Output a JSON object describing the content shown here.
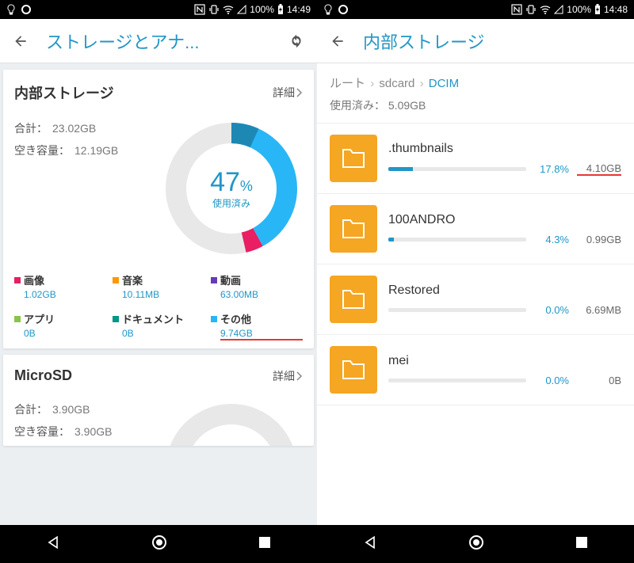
{
  "status": {
    "battery": "100%",
    "time_left": "14:49",
    "time_right": "14:48"
  },
  "left": {
    "title": "ストレージとアナ...",
    "card1": {
      "title": "内部ストレージ",
      "detail": "詳細",
      "total_lbl": "合計：",
      "total_val": "23.02GB",
      "free_lbl": "空き容量：",
      "free_val": "12.19GB",
      "pct": "47",
      "pct_sym": "%",
      "pct_lbl": "使用済み",
      "legend": [
        {
          "name": "画像",
          "val": "1.02GB",
          "color": "#e91e63"
        },
        {
          "name": "音楽",
          "val": "10.11MB",
          "color": "#ff9800"
        },
        {
          "name": "動画",
          "val": "63.00MB",
          "color": "#673ab7"
        },
        {
          "name": "アプリ",
          "val": "0B",
          "color": "#8bc34a"
        },
        {
          "name": "ドキュメント",
          "val": "0B",
          "color": "#009688"
        },
        {
          "name": "その他",
          "val": "9.74GB",
          "color": "#29b6f6",
          "underline": true
        }
      ]
    },
    "card2": {
      "title": "MicroSD",
      "detail": "詳細",
      "total_lbl": "合計：",
      "total_val": "3.90GB",
      "free_lbl": "空き容量：",
      "free_val": "3.90GB"
    }
  },
  "right": {
    "title": "内部ストレージ",
    "breadcrumb": {
      "root": "ルート",
      "mid": "sdcard",
      "cur": "DCIM"
    },
    "usage_lbl": "使用済み：",
    "usage_val": "5.09GB",
    "folders": [
      {
        "name": ".thumbnails",
        "pct": "17.8%",
        "pct_w": 17.8,
        "size": "4.10GB",
        "underline": true
      },
      {
        "name": "100ANDRO",
        "pct": "4.3%",
        "pct_w": 4.3,
        "size": "0.99GB"
      },
      {
        "name": "Restored",
        "pct": "0.0%",
        "pct_w": 0,
        "size": "6.69MB"
      },
      {
        "name": "mei",
        "pct": "0.0%",
        "pct_w": 0,
        "size": "0B"
      }
    ]
  },
  "chart_data": {
    "type": "pie",
    "title": "内部ストレージ 使用済み 47%",
    "total_gb": 23.02,
    "free_gb": 12.19,
    "used_pct": 47,
    "series": [
      {
        "name": "画像",
        "value": 1.02,
        "unit": "GB",
        "color": "#e91e63"
      },
      {
        "name": "音楽",
        "value": 10.11,
        "unit": "MB",
        "color": "#ff9800"
      },
      {
        "name": "動画",
        "value": 63.0,
        "unit": "MB",
        "color": "#673ab7"
      },
      {
        "name": "アプリ",
        "value": 0,
        "unit": "B",
        "color": "#8bc34a"
      },
      {
        "name": "ドキュメント",
        "value": 0,
        "unit": "B",
        "color": "#009688"
      },
      {
        "name": "その他",
        "value": 9.74,
        "unit": "GB",
        "color": "#29b6f6"
      },
      {
        "name": "空き",
        "value": 12.19,
        "unit": "GB",
        "color": "#e0e0e0"
      }
    ]
  }
}
